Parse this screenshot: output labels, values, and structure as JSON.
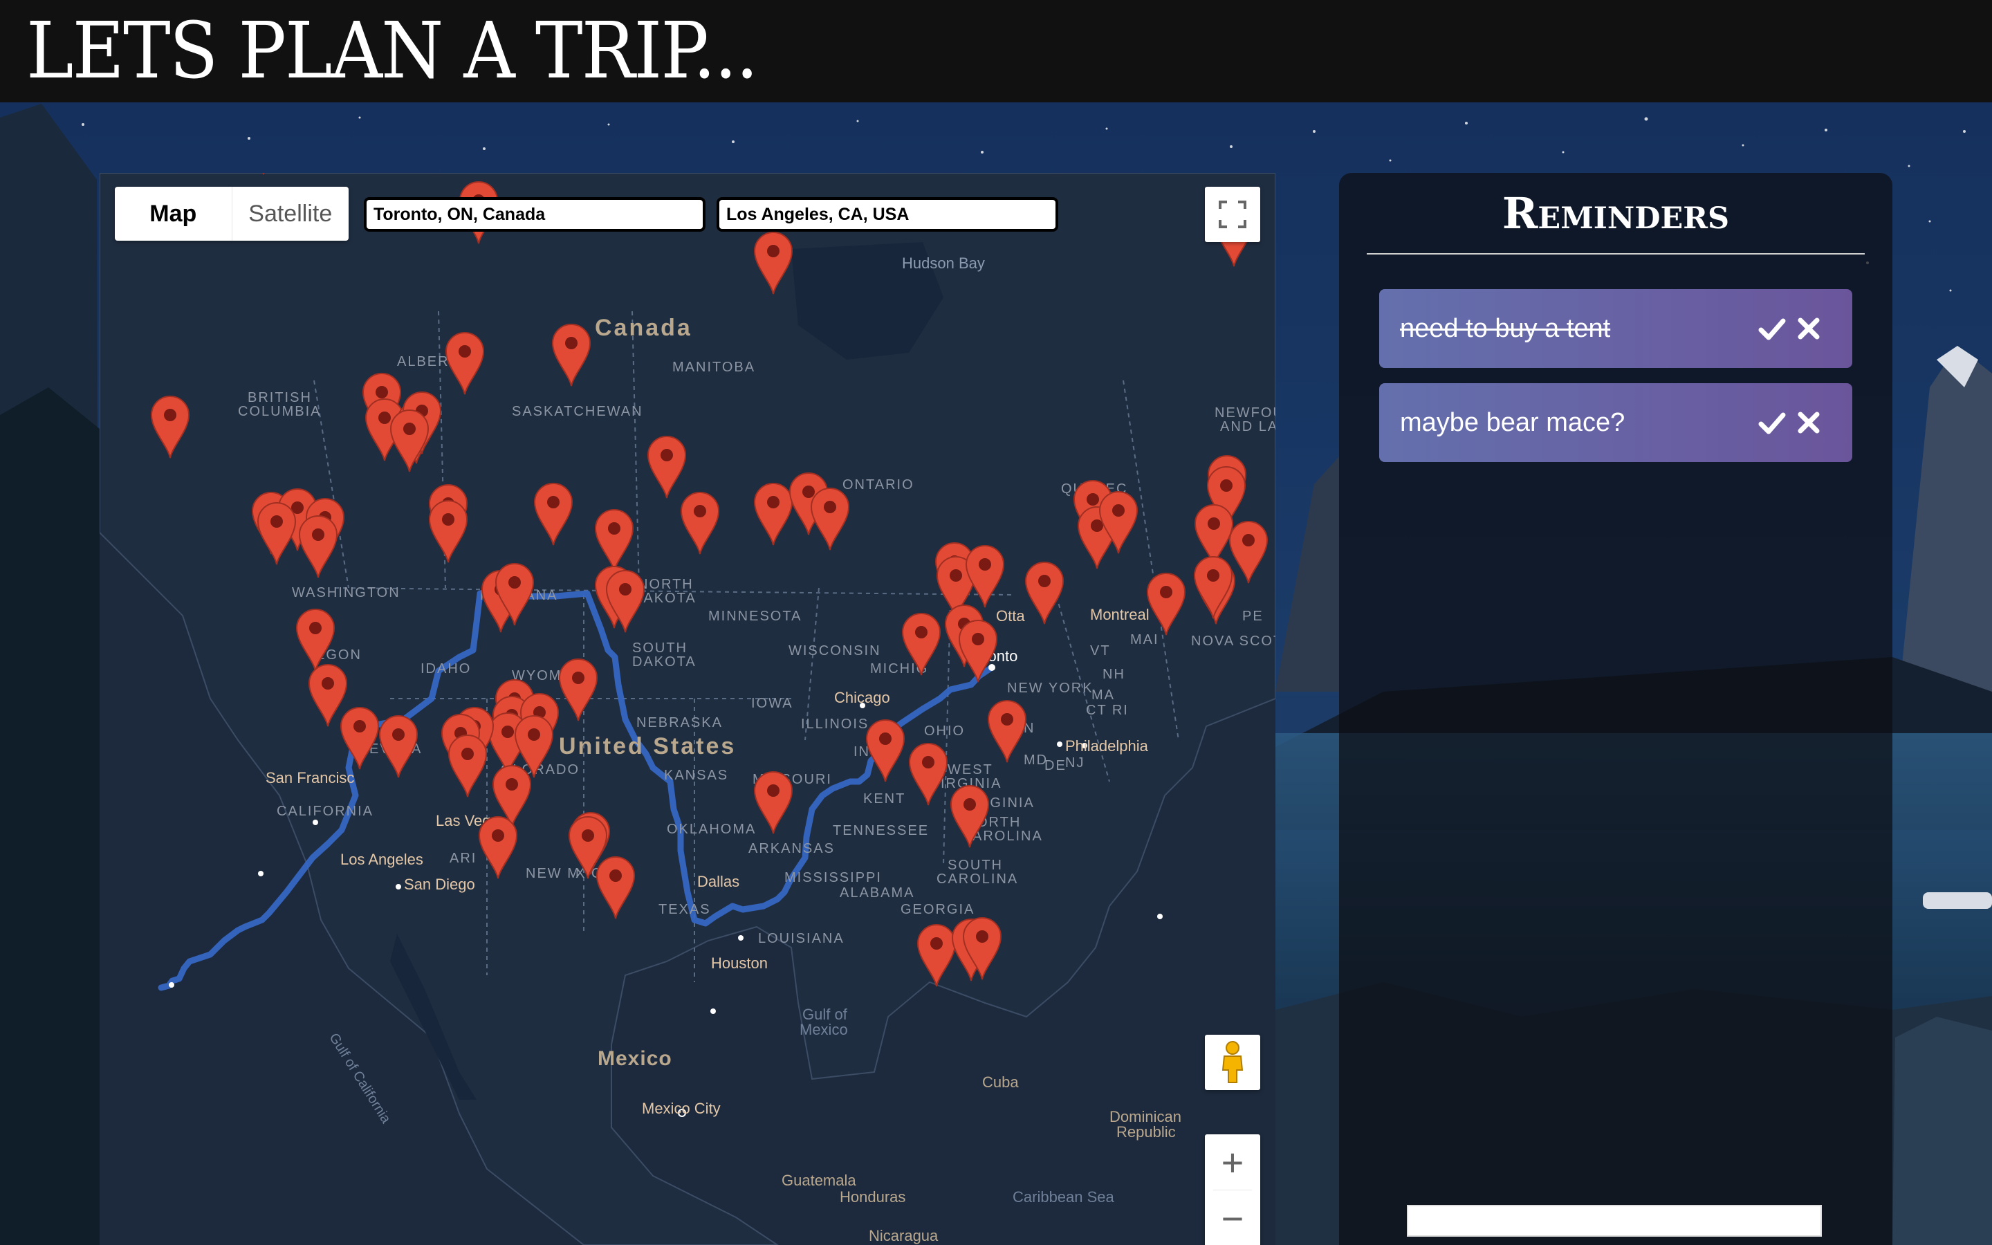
{
  "header": {
    "title": "LETS PLAN A TRIP..."
  },
  "map": {
    "map_type_buttons": [
      {
        "label": "Map"
      },
      {
        "label": "Satellite"
      }
    ],
    "origin_value": "Toronto, ON, Canada",
    "destination_value": "Los Angeles, CA, USA",
    "zoom_in_symbol": "+",
    "zoom_out_symbol": "−",
    "fullscreen_icon": "fullscreen-icon",
    "pegman_icon": "pegman-icon",
    "marker_icon": "map-marker-icon",
    "route_color": "#3669c9",
    "marker_color": "#e24a35",
    "labels": {
      "hudson_bay": "Hudson Bay",
      "canada": "Canada",
      "alberta": "ALBERTA",
      "manitoba": "MANITOBA",
      "british": "BRITISH",
      "columbia": "COLUMBIA",
      "saskatchewan": "SASKATCHEWAN",
      "ontario": "ONTARIO",
      "quebec": "QUEBEC",
      "newfoundland": "NEWFOU",
      "and_la": "AND LA",
      "washington": "WASHINGTON",
      "montana": "MONTANA",
      "north": "NORTH",
      "dakota": "DAKOTA",
      "minnesota": "MINNESOTA",
      "ottawa": "Otta",
      "montreal": "Montreal",
      "maine": "MAI",
      "pe": "PE",
      "nova_scotia": "NOVA SCOT",
      "oregon": "EGON",
      "idaho": "IDAHO",
      "wyoming": "WYOM",
      "south": "SOUTH",
      "wisconsin": "WISCONSIN",
      "michigan": "MICHIG",
      "toronto": "Toronto",
      "vt": "VT",
      "nh": "NH",
      "new_york": "NEW YORK",
      "ma": "MA",
      "ct_ri": "CT RI",
      "chicago": "Chicago",
      "iowa": "IOWA",
      "nebraska": "NEBRASKA",
      "illinois": "ILLINOIS",
      "nevada": "EVADA",
      "united_states": "United States",
      "ohio": "OHIO",
      "philadelphia": "Philadelphia",
      "nj": "NJ",
      "md": "MD",
      "de": "DE",
      "n": "N",
      "san_francisco": "San Francisc",
      "colorado": "OLORADO",
      "kansas": "KANSAS",
      "missouri": "MISSOURI",
      "kentucky": "KENT",
      "in": "IN",
      "west": "WEST",
      "virginia_w": "IRGINIA",
      "virginia": "VIRGINIA",
      "california": "CALIFORNIA",
      "las_vegas": "Las Vegas",
      "oklahoma": "OKLAHOMA",
      "arkansas": "ARKANSAS",
      "tennessee": "TENNESSEE",
      "orth": "ORTH",
      "arolina": "AROLINA",
      "los_angeles": "Los Angeles",
      "arizona": "ARI",
      "san_diego": "San Diego",
      "new_mexico": "NEW M",
      "exico": "XICO",
      "dallas": "Dallas",
      "mississippi": "MISSISSIPPI",
      "south2": "SOUTH",
      "carolina": "CAROLINA",
      "alabama": "ALABAMA",
      "texas": "TEXAS",
      "georgia": "GEORGIA",
      "louisiana": "LOUISIANA",
      "houston": "Houston",
      "gulf_of_california": "Gulf of California",
      "gulf_of": "Gulf of",
      "mexico_gulf": "Mexico",
      "mexico": "Mexico",
      "cuba": "Cuba",
      "dominican": "Dominican",
      "republic": "Republic",
      "mexico_city": "Mexico City",
      "guatemala": "Guatemala",
      "honduras": "Honduras",
      "caribbean_sea": "Caribbean Sea",
      "nicaragua": "Nicaragua"
    }
  },
  "reminders": {
    "title": "Reminders",
    "items": [
      {
        "text": "need to buy a tent",
        "completed": true,
        "check_icon": "check-icon",
        "delete_icon": "close-icon"
      },
      {
        "text": "maybe bear mace?",
        "completed": false,
        "check_icon": "check-icon",
        "delete_icon": "close-icon"
      }
    ],
    "new_reminder_value": ""
  }
}
